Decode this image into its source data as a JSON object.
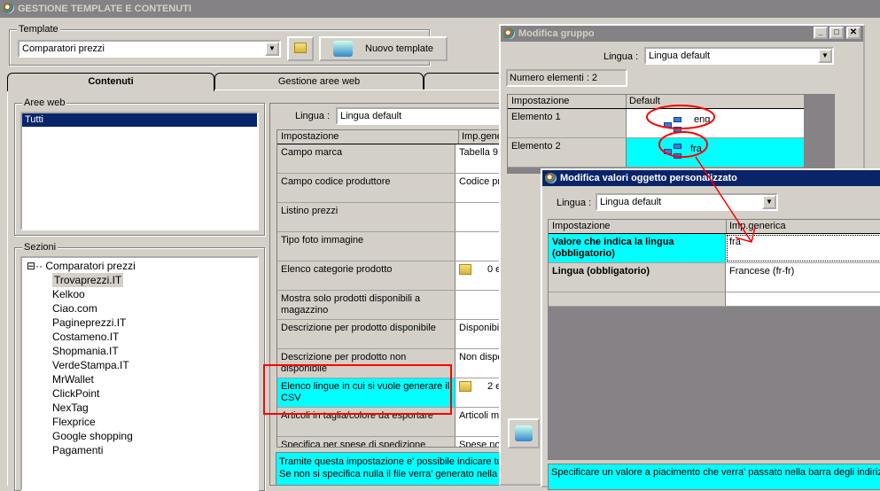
{
  "main_window": {
    "title": "GESTIONE TEMPLATE E CONTENUTI",
    "template_group": "Template",
    "template_value": "Comparatori prezzi",
    "new_template_button": "Nuovo template",
    "tabs": [
      {
        "label": "Contenuti",
        "active": true
      },
      {
        "label": "Gestione aree web"
      }
    ],
    "aree_web_group": "Aree web",
    "aree_web_items": [
      "Tutti"
    ],
    "sezioni_group": "Sezioni",
    "tree_root": "Comparatori prezzi",
    "tree_items": [
      "Trovaprezzi.IT",
      "Kelkoo",
      "Ciao.com",
      "Pagineprezzi.IT",
      "Costameno.IT",
      "Shopmania.IT",
      "VerdeStampa.IT",
      "MrWallet",
      "ClickPoint",
      "NexTag",
      "Flexprice",
      "Google shopping",
      "Pagamenti"
    ],
    "lingua_label": "Lingua :",
    "lingua_value": "Lingua default",
    "grid_headers": [
      "Impostazione",
      "Imp.gene"
    ],
    "grid_rows": [
      {
        "name": "Campo marca",
        "value": "Tabella 9"
      },
      {
        "name": "Campo codice produttore",
        "value": "Codice pr"
      },
      {
        "name": "Listino prezzi",
        "value": ""
      },
      {
        "name": "Tipo foto immagine",
        "value": ""
      },
      {
        "name": "Elenco categorie prodotto",
        "value": "0 e"
      },
      {
        "name": "Mostra solo prodotti disponibili a magazzino",
        "value": ""
      },
      {
        "name": "Descrizione per prodotto disponibile",
        "value": "Disponibil"
      },
      {
        "name": "Descrizione per prodotto non disponibile",
        "value": "Non dispo"
      },
      {
        "name": "Elenco lingue in cui si vuole generare il CSV",
        "value": "2 e"
      },
      {
        "name": "Articoli in taglia/colore da esportare",
        "value": "Articoli ma"
      },
      {
        "name": "Specifica per spese di spedizione",
        "value": "Spese no"
      }
    ],
    "description": [
      "Tramite questa impostazione e' possibile indicare tutte le lingue",
      "Se non si specifica nulla il file verra' generato nella lingua di D"
    ]
  },
  "group_dialog": {
    "title": "Modifica gruppo",
    "lingua_label": "Lingua :",
    "lingua_value": "Lingua default",
    "count": "Numero elementi : 2",
    "grid_headers": [
      "Impostazione",
      "Default"
    ],
    "rows": [
      {
        "name": "Elemento 1",
        "value": "eng"
      },
      {
        "name": "Elemento 2",
        "value": "fra"
      }
    ]
  },
  "object_dialog": {
    "title": "Modifica valori oggetto personalizzato",
    "lingua_label": "Lingua :",
    "lingua_value": "Lingua default",
    "grid_headers": [
      "Impostazione",
      "Imp.generica"
    ],
    "rows": [
      {
        "name": "Valore che indica la lingua (obbligatorio)",
        "value": "fra"
      },
      {
        "name": "Lingua (obbligatorio)",
        "value": "Francese (fr-fr)"
      }
    ],
    "description": "Specificare un valore a piacimento che verra' passato nella barra degli indirizzi"
  },
  "colors": {
    "highlight": "#00ffff",
    "annotation": "#ff0000",
    "selection": "#0a246a"
  }
}
